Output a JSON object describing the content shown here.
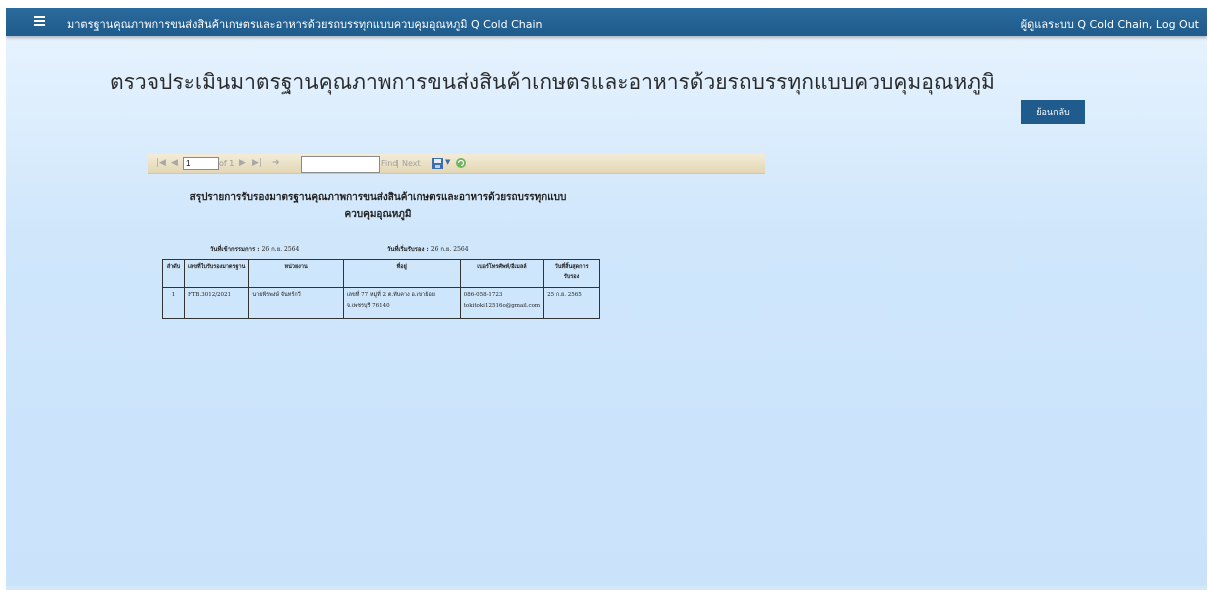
{
  "header": {
    "app_title": "มาตรฐานคุณภาพการขนส่งสินค้าเกษตรและอาหารด้วยรถบรรทุกแบบควบคุมอุณหภูมิ Q Cold Chain",
    "user_text": "ผู้ดูแลระบบ Q Cold Chain,",
    "logout_label": "Log Out",
    "menu_icon": "hamburger-menu-icon"
  },
  "main": {
    "page_title": "ตรวจประเมินมาตรฐานคุณภาพการขนส่งสินค้าเกษตรและอาหารด้วยรถบรรทุกแบบควบคุมอุณหภูมิ",
    "back_label": "ย้อนกลับ"
  },
  "report_toolbar": {
    "page_value": "1",
    "page_of": "of 1",
    "find_value": "",
    "find_label": "Find",
    "separator": "|",
    "next_label": "Next"
  },
  "report": {
    "title_line1": "สรุปรายการรับรองมาตรฐานคุณภาพการขนส่งสินค้าเกษตรและอาหารด้วยรถบรรทุกแบบ",
    "title_line2": "ควบคุมอุณหภูมิ",
    "date1_label": "วันที่เข้ากรรมการ :",
    "date1_value": "26 ก.ย. 2564",
    "date2_label": "วันที่เริ่มรับรอง :",
    "date2_value": "26 ก.ย. 2564",
    "columns": [
      "ลำดับ",
      "เลขที่ใบรับรองมาตรฐาน",
      "หน่วยงาน",
      "ที่อยู่",
      "เบอร์โทรศัพท์/อีเมลล์",
      "วันที่สิ้นสุดการรับรอง"
    ],
    "rows": [
      {
        "no": "1",
        "cert_no": "FTB.3012/2021",
        "org": "นายพีรพงษ์ จันทร์กวี",
        "address_line1": "เลขที่ 77 หมู่ที่ 2 ต.ทับคาง อ.เขาย้อย",
        "address_line2": "จ.เพชรบุรี 76140",
        "phone": "086-058-1723",
        "email": "tokitoki12516o@gmail.com",
        "end_date": "25 ก.ย. 2565"
      }
    ]
  },
  "colors": {
    "topbar": "#1f5b8d",
    "button": "#1f5b8d",
    "background": "#cfe6fb",
    "toolbar": "#e3d6b4"
  }
}
